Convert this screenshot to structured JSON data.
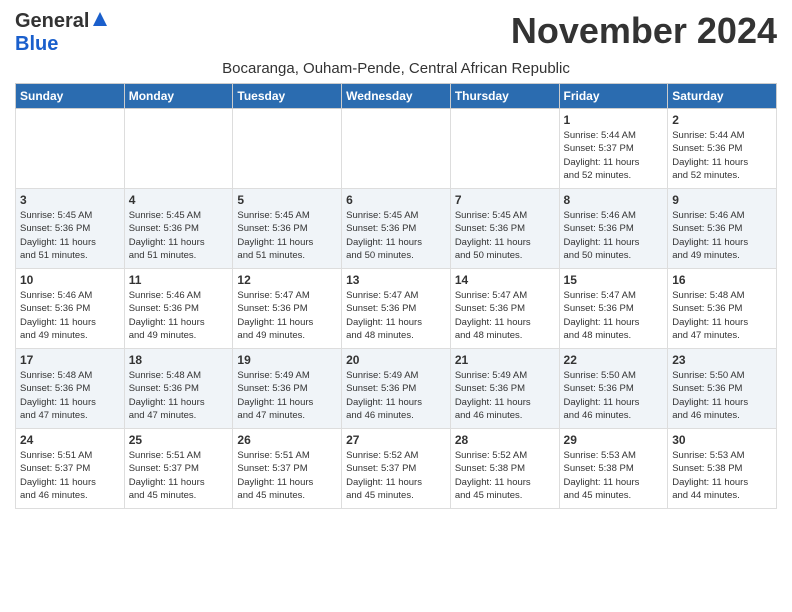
{
  "header": {
    "logo_general": "General",
    "logo_blue": "Blue",
    "month_year": "November 2024",
    "subtitle": "Bocaranga, Ouham-Pende, Central African Republic"
  },
  "weekdays": [
    "Sunday",
    "Monday",
    "Tuesday",
    "Wednesday",
    "Thursday",
    "Friday",
    "Saturday"
  ],
  "weeks": [
    [
      {
        "day": "",
        "info": ""
      },
      {
        "day": "",
        "info": ""
      },
      {
        "day": "",
        "info": ""
      },
      {
        "day": "",
        "info": ""
      },
      {
        "day": "",
        "info": ""
      },
      {
        "day": "1",
        "info": "Sunrise: 5:44 AM\nSunset: 5:37 PM\nDaylight: 11 hours\nand 52 minutes."
      },
      {
        "day": "2",
        "info": "Sunrise: 5:44 AM\nSunset: 5:36 PM\nDaylight: 11 hours\nand 52 minutes."
      }
    ],
    [
      {
        "day": "3",
        "info": "Sunrise: 5:45 AM\nSunset: 5:36 PM\nDaylight: 11 hours\nand 51 minutes."
      },
      {
        "day": "4",
        "info": "Sunrise: 5:45 AM\nSunset: 5:36 PM\nDaylight: 11 hours\nand 51 minutes."
      },
      {
        "day": "5",
        "info": "Sunrise: 5:45 AM\nSunset: 5:36 PM\nDaylight: 11 hours\nand 51 minutes."
      },
      {
        "day": "6",
        "info": "Sunrise: 5:45 AM\nSunset: 5:36 PM\nDaylight: 11 hours\nand 50 minutes."
      },
      {
        "day": "7",
        "info": "Sunrise: 5:45 AM\nSunset: 5:36 PM\nDaylight: 11 hours\nand 50 minutes."
      },
      {
        "day": "8",
        "info": "Sunrise: 5:46 AM\nSunset: 5:36 PM\nDaylight: 11 hours\nand 50 minutes."
      },
      {
        "day": "9",
        "info": "Sunrise: 5:46 AM\nSunset: 5:36 PM\nDaylight: 11 hours\nand 49 minutes."
      }
    ],
    [
      {
        "day": "10",
        "info": "Sunrise: 5:46 AM\nSunset: 5:36 PM\nDaylight: 11 hours\nand 49 minutes."
      },
      {
        "day": "11",
        "info": "Sunrise: 5:46 AM\nSunset: 5:36 PM\nDaylight: 11 hours\nand 49 minutes."
      },
      {
        "day": "12",
        "info": "Sunrise: 5:47 AM\nSunset: 5:36 PM\nDaylight: 11 hours\nand 49 minutes."
      },
      {
        "day": "13",
        "info": "Sunrise: 5:47 AM\nSunset: 5:36 PM\nDaylight: 11 hours\nand 48 minutes."
      },
      {
        "day": "14",
        "info": "Sunrise: 5:47 AM\nSunset: 5:36 PM\nDaylight: 11 hours\nand 48 minutes."
      },
      {
        "day": "15",
        "info": "Sunrise: 5:47 AM\nSunset: 5:36 PM\nDaylight: 11 hours\nand 48 minutes."
      },
      {
        "day": "16",
        "info": "Sunrise: 5:48 AM\nSunset: 5:36 PM\nDaylight: 11 hours\nand 47 minutes."
      }
    ],
    [
      {
        "day": "17",
        "info": "Sunrise: 5:48 AM\nSunset: 5:36 PM\nDaylight: 11 hours\nand 47 minutes."
      },
      {
        "day": "18",
        "info": "Sunrise: 5:48 AM\nSunset: 5:36 PM\nDaylight: 11 hours\nand 47 minutes."
      },
      {
        "day": "19",
        "info": "Sunrise: 5:49 AM\nSunset: 5:36 PM\nDaylight: 11 hours\nand 47 minutes."
      },
      {
        "day": "20",
        "info": "Sunrise: 5:49 AM\nSunset: 5:36 PM\nDaylight: 11 hours\nand 46 minutes."
      },
      {
        "day": "21",
        "info": "Sunrise: 5:49 AM\nSunset: 5:36 PM\nDaylight: 11 hours\nand 46 minutes."
      },
      {
        "day": "22",
        "info": "Sunrise: 5:50 AM\nSunset: 5:36 PM\nDaylight: 11 hours\nand 46 minutes."
      },
      {
        "day": "23",
        "info": "Sunrise: 5:50 AM\nSunset: 5:36 PM\nDaylight: 11 hours\nand 46 minutes."
      }
    ],
    [
      {
        "day": "24",
        "info": "Sunrise: 5:51 AM\nSunset: 5:37 PM\nDaylight: 11 hours\nand 46 minutes."
      },
      {
        "day": "25",
        "info": "Sunrise: 5:51 AM\nSunset: 5:37 PM\nDaylight: 11 hours\nand 45 minutes."
      },
      {
        "day": "26",
        "info": "Sunrise: 5:51 AM\nSunset: 5:37 PM\nDaylight: 11 hours\nand 45 minutes."
      },
      {
        "day": "27",
        "info": "Sunrise: 5:52 AM\nSunset: 5:37 PM\nDaylight: 11 hours\nand 45 minutes."
      },
      {
        "day": "28",
        "info": "Sunrise: 5:52 AM\nSunset: 5:38 PM\nDaylight: 11 hours\nand 45 minutes."
      },
      {
        "day": "29",
        "info": "Sunrise: 5:53 AM\nSunset: 5:38 PM\nDaylight: 11 hours\nand 45 minutes."
      },
      {
        "day": "30",
        "info": "Sunrise: 5:53 AM\nSunset: 5:38 PM\nDaylight: 11 hours\nand 44 minutes."
      }
    ]
  ]
}
